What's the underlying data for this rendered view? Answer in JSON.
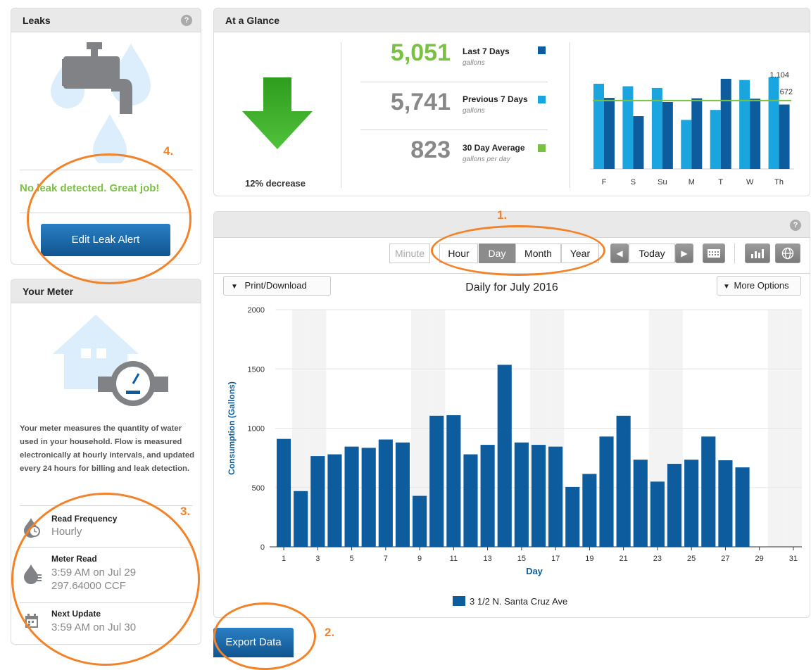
{
  "leaks": {
    "title": "Leaks",
    "help": "?",
    "status": "No leak detected. Great job!",
    "edit_button": "Edit Leak Alert"
  },
  "meter": {
    "title": "Your Meter",
    "description": "Your meter measures the quantity of water used in your household. Flow is measured electronically at hourly intervals, and updated every 24 hours for billing and leak detection.",
    "read_frequency_label": "Read Frequency",
    "read_frequency_value": "Hourly",
    "meter_read_label": "Meter Read",
    "meter_read_time": "3:59 AM on Jul 29",
    "meter_read_value": "297.64000 CCF",
    "next_update_label": "Next Update",
    "next_update_value": "3:59 AM on Jul 30"
  },
  "glance": {
    "title": "At a Glance",
    "change_label": "12% decrease",
    "stats": [
      {
        "value": "5,051",
        "label": "Last 7 Days",
        "unit": "gallons",
        "color": "#7ac143",
        "swatch": "#0d5c9e"
      },
      {
        "value": "5,741",
        "label": "Previous 7 Days",
        "unit": "gallons",
        "color": "#888888",
        "swatch": "#1aa5de"
      },
      {
        "value": "823",
        "label": "30 Day Average",
        "unit": "gallons per day",
        "color": "#888888",
        "swatch": "#7ac143"
      }
    ]
  },
  "toolbar": {
    "minute": "Minute",
    "hour": "Hour",
    "day": "Day",
    "month": "Month",
    "year": "Year",
    "today": "Today",
    "print_download": "Print/Download",
    "more_options": "More Options",
    "export": "Export Data"
  },
  "annotations": {
    "a1": "1.",
    "a2": "2.",
    "a3": "3.",
    "a4": "4."
  },
  "icons": [
    "faucet-icon",
    "water-drop-icon",
    "house-icon",
    "meter-gauge-icon",
    "clock-drop-icon",
    "meter-drop-icon",
    "calendar-icon",
    "help-icon",
    "bar-chart-icon",
    "globe-icon",
    "calendar-grid-icon"
  ],
  "colors": {
    "primary_blue": "#0d5c9e",
    "light_blue": "#1aa5de",
    "green": "#7ac143",
    "annotation_orange": "#f2832a",
    "arrow_green": "#3fae29"
  },
  "chart_data": [
    {
      "type": "bar",
      "categories": [
        "F",
        "S",
        "Su",
        "M",
        "T",
        "W",
        "Th"
      ],
      "series": [
        {
          "name": "Previous 7 Days",
          "color": "#1aa5de",
          "values": [
            1025,
            995,
            975,
            590,
            710,
            1070,
            1104
          ]
        },
        {
          "name": "Last 7 Days",
          "color": "#0d5c9e",
          "values": [
            855,
            635,
            805,
            850,
            1085,
            845,
            775
          ]
        }
      ],
      "average": 823,
      "annotations": [
        "1,104",
        "672"
      ],
      "ylim": [
        0,
        1220
      ]
    },
    {
      "type": "bar",
      "title": "Daily for July 2016",
      "xlabel": "Day",
      "ylabel": "Consumption (Gallons)",
      "categories": [
        1,
        2,
        3,
        4,
        5,
        6,
        7,
        8,
        9,
        10,
        11,
        12,
        13,
        14,
        15,
        16,
        17,
        18,
        19,
        20,
        21,
        22,
        23,
        24,
        25,
        26,
        27,
        28,
        29,
        30,
        31
      ],
      "x_ticks": [
        1,
        3,
        5,
        7,
        9,
        11,
        13,
        15,
        17,
        19,
        21,
        23,
        25,
        27,
        29,
        31
      ],
      "y_ticks": [
        0,
        500,
        1000,
        1500,
        2000
      ],
      "ylim": [
        0,
        2000
      ],
      "series": [
        {
          "name": "3 1/2 N. Santa Cruz Ave",
          "color": "#0d5c9e",
          "values": [
            910,
            470,
            765,
            780,
            845,
            835,
            905,
            880,
            430,
            1105,
            1110,
            780,
            860,
            1535,
            880,
            860,
            845,
            505,
            615,
            930,
            1105,
            735,
            550,
            700,
            735,
            930,
            730,
            670,
            null,
            null,
            null
          ]
        }
      ]
    }
  ]
}
